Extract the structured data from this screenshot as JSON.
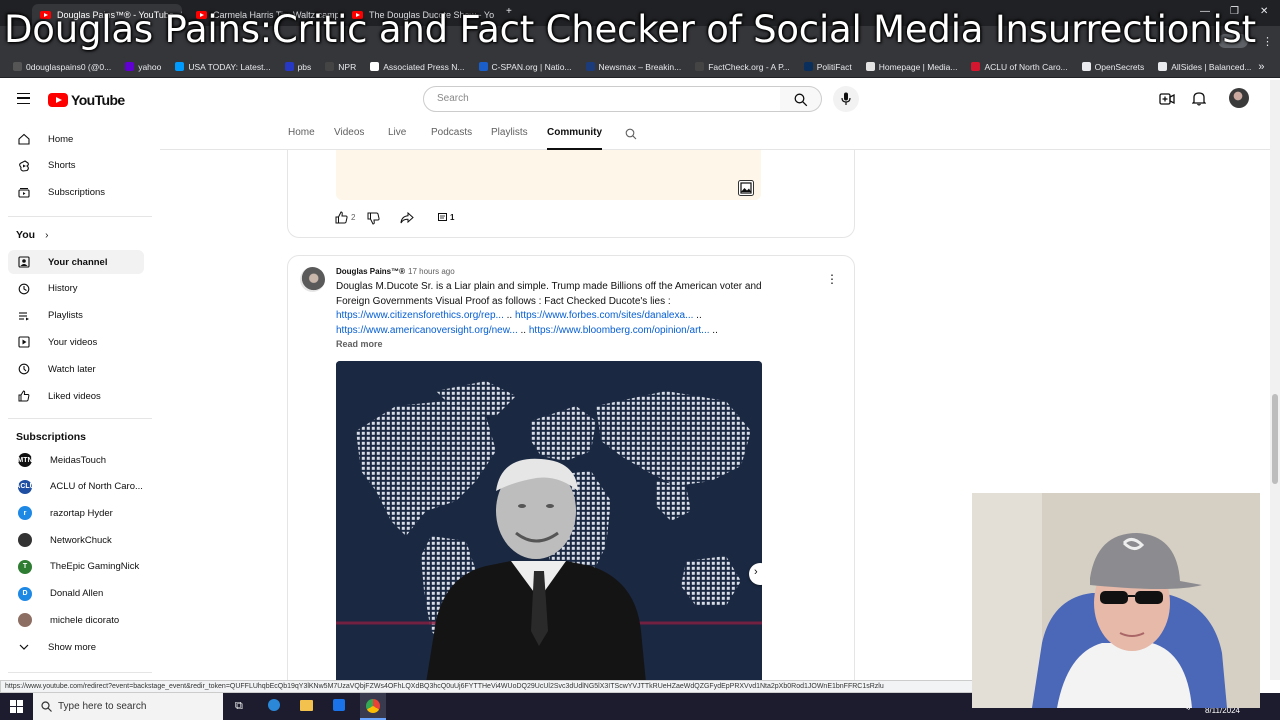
{
  "overlay_title": "Douglas Pains:Critic and Fact Checker of Social Media Insurrectionist",
  "browser": {
    "tabs": [
      {
        "title": "Douglas Pains™® - YouTube"
      },
      {
        "title": "Carmela Harris Tim Waltz camp"
      },
      {
        "title": "The Douglas Ducote Show - Yo"
      }
    ],
    "bookmarks": [
      {
        "label": "0douglaspains0 (@0...",
        "color": "#555555"
      },
      {
        "label": "yahoo",
        "color": "#6001d2"
      },
      {
        "label": "USA TODAY: Latest...",
        "color": "#009bff"
      },
      {
        "label": "pbs",
        "color": "#2638c4"
      },
      {
        "label": "NPR",
        "color": "#444444"
      },
      {
        "label": "Associated Press N...",
        "color": "#ffffff"
      },
      {
        "label": "C-SPAN.org | Natio...",
        "color": "#1a5ec9"
      },
      {
        "label": "Newsmax – Breakin...",
        "color": "#1c3b7b"
      },
      {
        "label": "FactCheck.org - A P...",
        "color": "#444444"
      },
      {
        "label": "PolitiFact",
        "color": "#0b2f5c"
      },
      {
        "label": "Homepage | Media...",
        "color": "#e3e3e3"
      },
      {
        "label": "ACLU of North Caro...",
        "color": "#d4172e"
      },
      {
        "label": "OpenSecrets",
        "color": "#e8eaed"
      },
      {
        "label": "AllSides | Balanced...",
        "color": "#e8eaed"
      }
    ]
  },
  "youtube": {
    "logo_text": "YouTube",
    "search_placeholder": "Search",
    "sidebar": {
      "main": [
        {
          "label": "Home",
          "icon": "home-icon"
        },
        {
          "label": "Shorts",
          "icon": "shorts-icon"
        },
        {
          "label": "Subscriptions",
          "icon": "subscriptions-icon"
        }
      ],
      "you_heading": "You",
      "you_items": [
        {
          "label": "Your channel",
          "icon": "channel-icon"
        },
        {
          "label": "History",
          "icon": "history-icon"
        },
        {
          "label": "Playlists",
          "icon": "playlists-icon"
        },
        {
          "label": "Your videos",
          "icon": "your-videos-icon"
        },
        {
          "label": "Watch later",
          "icon": "watch-later-icon"
        },
        {
          "label": "Liked videos",
          "icon": "like-icon"
        }
      ],
      "subscriptions_heading": "Subscriptions",
      "subscriptions": [
        {
          "label": "MeidasTouch",
          "avatar": "MTN",
          "color": "#111111"
        },
        {
          "label": "ACLU of North Caro...",
          "avatar": "ACLU",
          "color": "#1f4fa3"
        },
        {
          "label": "razortap Hyder",
          "avatar": "r",
          "color": "#1e88e5"
        },
        {
          "label": "NetworkChuck",
          "avatar": "",
          "color": "#333333"
        },
        {
          "label": "TheEpic GamingNick",
          "avatar": "T",
          "color": "#2e7d32"
        },
        {
          "label": "Donald Allen",
          "avatar": "D",
          "color": "#1e88e5"
        },
        {
          "label": "michele dicorato",
          "avatar": "",
          "color": "#8d6e63"
        }
      ],
      "show_more": "Show more"
    },
    "channel_tabs": [
      "Home",
      "Videos",
      "Live",
      "Podcasts",
      "Playlists",
      "Community"
    ],
    "active_tab": "Community",
    "prev_post": {
      "like_count": "2",
      "comment_count": "1"
    },
    "post": {
      "author": "Douglas Pains™®",
      "time": "17 hours ago",
      "text_line1": "Douglas M.Ducote Sr. is a Liar plain and simple. Trump made Billions off the American voter and",
      "text_line2": "Foreign Governments Visual Proof as follows : Fact Checked Ducote's lies :",
      "link1": "https://www.citizensforethics.org/rep...",
      "link2": "https://www.forbes.com/sites/danalexa...",
      "link3": "https://www.americanoversight.org/new...",
      "link4": "https://www.bloomberg.com/opinion/art...",
      "read_more": "Read more"
    }
  },
  "status_url": "https://www.youtube.com/redirect?event=backstage_event&redir_token=QUFFLUhqbEcQb19qY3lKNw5M7UzaVQbjFZWs4OFhLQXdBQ3hcQ0uUj6FYTTHeVi4WUoDQ29UcUl2Svc3dUdlNG5lX3ITScwYVJTTkRUeHZaeWdQZGFydEpPRXVvd1Nta2pXb0Rod1JOWnE1bnFFRC1sRzlu",
  "taskbar": {
    "search_placeholder": "Type here to search",
    "date": "8/11/2024"
  }
}
